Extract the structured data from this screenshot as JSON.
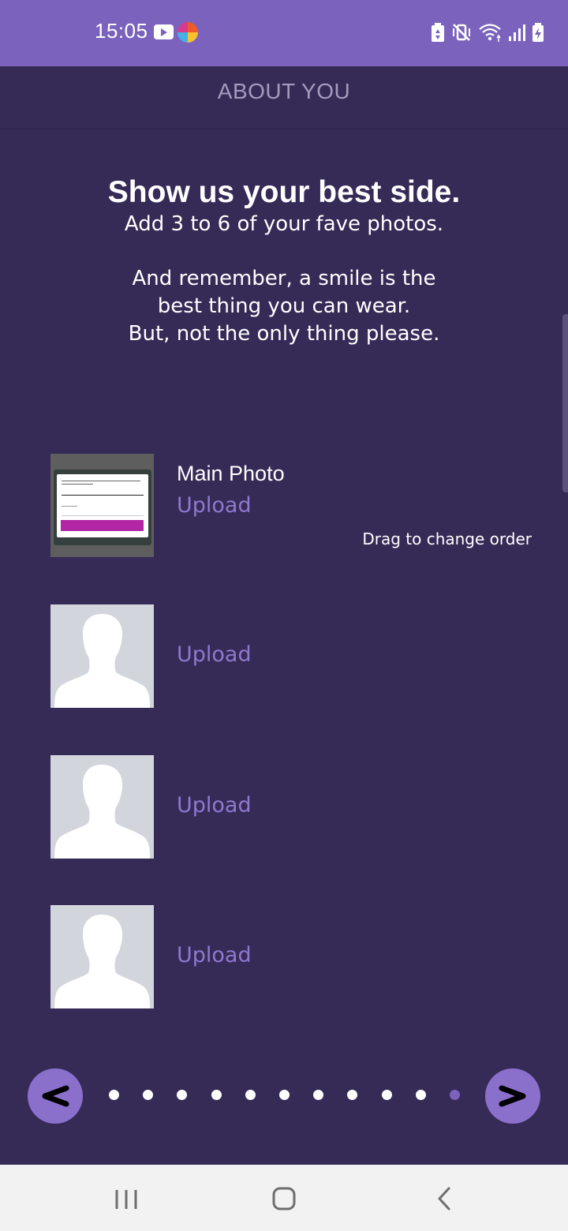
{
  "status_bar": {
    "time": "15:05",
    "icons": [
      "youtube-icon",
      "app-icon",
      "battery-saver-icon",
      "mute-vibrate-icon",
      "wifi-icon",
      "signal-icon",
      "battery-charging-icon"
    ],
    "background": "#7b62bc"
  },
  "header": {
    "title": "ABOUT YOU"
  },
  "intro": {
    "headline": "Show us your best side.",
    "subtitle": "Add 3 to 6 of your fave photos.",
    "note_lines": [
      "And remember, a smile is the",
      "best thing you can wear.",
      "But, not the only thing please."
    ]
  },
  "photos": {
    "main_label": "Main Photo",
    "drag_hint": "Drag to change order",
    "slots": [
      {
        "upload_label": "Upload",
        "has_photo": true
      },
      {
        "upload_label": "Upload",
        "has_photo": false
      },
      {
        "upload_label": "Upload",
        "has_photo": false
      },
      {
        "upload_label": "Upload",
        "has_photo": false
      }
    ]
  },
  "pager": {
    "prev_icon": "chevron-left-icon",
    "next_icon": "chevron-right-icon",
    "total_steps": 11,
    "current_step": 11
  },
  "colors": {
    "background": "#362a57",
    "accent": "#8a70cb",
    "link": "#8f78cf"
  }
}
